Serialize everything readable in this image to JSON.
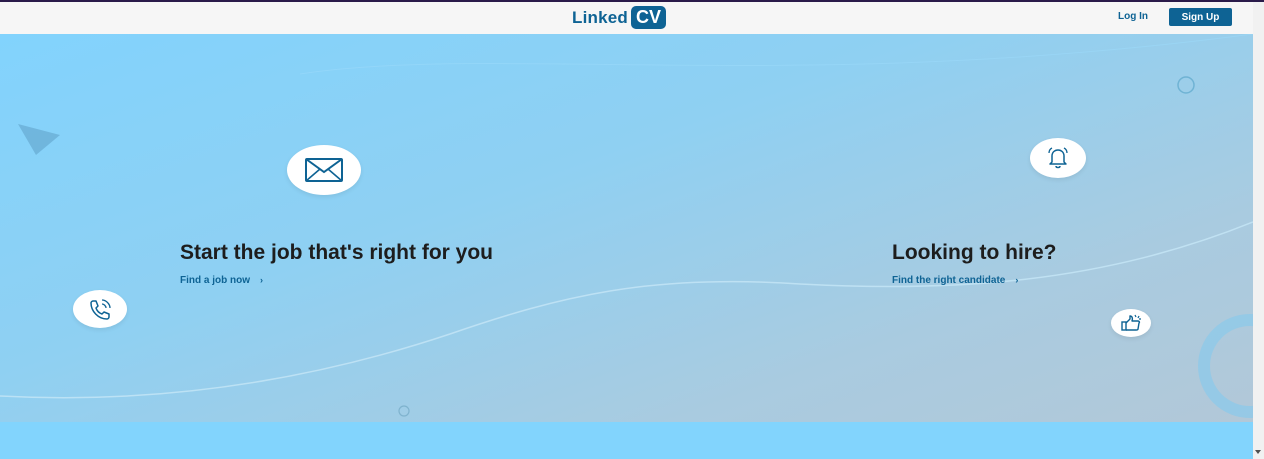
{
  "header": {
    "logo_text": "Linked",
    "logo_badge": "CV",
    "login_label": "Log In",
    "signup_label": "Sign Up"
  },
  "hero": {
    "left": {
      "title": "Start the job that's right for you",
      "link": "Find a job now",
      "icon": "envelope-icon"
    },
    "right": {
      "title": "Looking to hire?",
      "link": "Find the right candidate",
      "icon": "bell-icon"
    },
    "extra_icons": [
      "phone-icon",
      "thumbs-up-icon"
    ],
    "chevron": "›"
  },
  "colors": {
    "brand": "#0e6394",
    "hero_light": "#82d3fd",
    "hero_dark": "#b2c8d8"
  }
}
